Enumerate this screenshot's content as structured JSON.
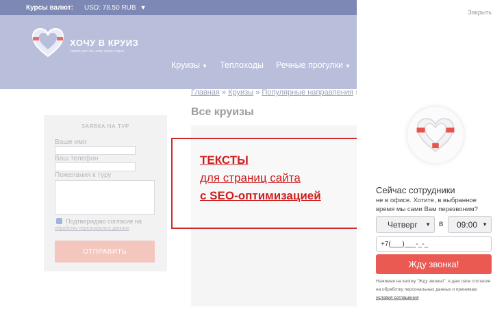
{
  "topbar": {
    "rates_label": "Курсы валют:",
    "usd": "USD:  78.50 RUB"
  },
  "brand": {
    "name": "ХОЧУ В КРУИЗ",
    "tagline": "сервис для тех, кому нужен отдых"
  },
  "nav": {
    "items": [
      {
        "label": "Круизы",
        "dropdown": true
      },
      {
        "label": "Теплоходы",
        "dropdown": false
      },
      {
        "label": "Речные прогулки",
        "dropdown": true
      }
    ]
  },
  "breadcrumb": {
    "items": [
      "Главная",
      "Круизы",
      "Популярные направления"
    ],
    "separator": "»"
  },
  "page": {
    "title": "Все круизы"
  },
  "request_form": {
    "title": "ЗАЯВКА НА ТУР",
    "name_label": "Ваше имя",
    "phone_label": "Ваш телефон",
    "wishes_label": "Пожелания к туру",
    "consent": "Подтверждаю согласие на",
    "consent_link": "обработку персональных данных",
    "submit": "ОТПРАВИТЬ"
  },
  "promo": {
    "line1": "ТЕКСТЫ",
    "line2": "для страниц сайта",
    "line3": "с SEO-оптимизацией"
  },
  "callback": {
    "close": "Закрыть",
    "heading": "Сейчас сотрудники",
    "text": "не в офисе. Хотите, в выбранное время мы сами Вам перезвоним?",
    "day": "Четверг",
    "in": "в",
    "time": "09:00",
    "phone_value": "+7(___)___-_-_",
    "button": "Жду звонка!",
    "legal_text": "Нажимая на кнопку \"Жду звонка!\", я даю свое согласие на обработку персональных данных и принимаю",
    "legal_link": "условия соглашения"
  },
  "colors": {
    "topbar": "#7d88b4",
    "header": "#b9bedb",
    "promo_red": "#cc1f1f",
    "call_button": "#ea5a52"
  }
}
